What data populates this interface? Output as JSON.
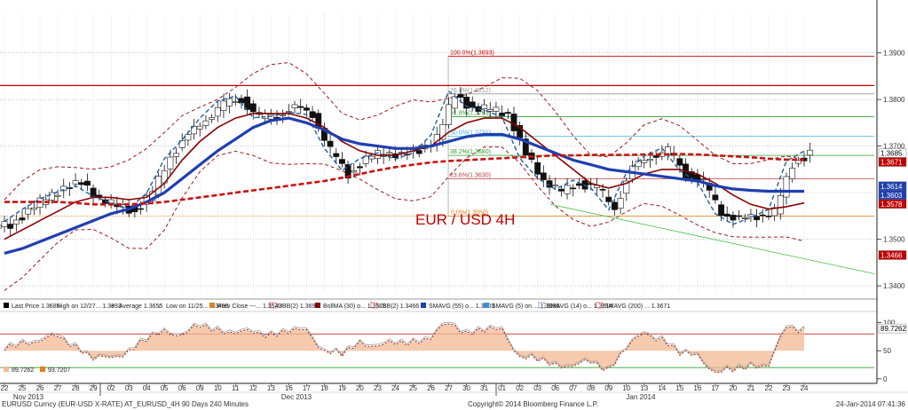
{
  "chart_data": {
    "type": "candlestick",
    "title": "EUR / USD 4H",
    "y_price_ticks": [
      "1.3900",
      "1.3800",
      "1.3700",
      "1.3500",
      "1.3400"
    ],
    "y_osc_ticks": [
      "100",
      "50",
      "0"
    ],
    "ylim_price": [
      1.3385,
      1.3985
    ],
    "ylim_osc": [
      -5,
      112
    ],
    "x_day_labels": [
      "22",
      "25",
      "26",
      "27",
      "28",
      "29",
      "02",
      "03",
      "04",
      "05",
      "06",
      "09",
      "10",
      "11",
      "12",
      "13",
      "16",
      "17",
      "18",
      "19",
      "20",
      "23",
      "24",
      "25",
      "26",
      "27",
      "30",
      "31",
      "01",
      "02",
      "03",
      "06",
      "07",
      "08",
      "09",
      "10",
      "13",
      "14",
      "15",
      "16",
      "17",
      "20",
      "21",
      "22",
      "23",
      "24"
    ],
    "month_labels": [
      "Nov 2013",
      "Dec 2013",
      "Jan 2014"
    ],
    "price_badges": [
      {
        "label": "1.3685",
        "value": 1.3685,
        "bg": "#ffffff",
        "fg": "#000000"
      },
      {
        "label": "1.3671",
        "value": 1.3671,
        "bg": "#c00000",
        "fg": "#ffffff"
      },
      {
        "label": "1.3614",
        "value": 1.3614,
        "bg": "#1f3fb0",
        "fg": "#ffffff"
      },
      {
        "label": "1.3603",
        "value": 1.3603,
        "bg": "#1f3fb0",
        "fg": "#ffffff"
      },
      {
        "label": "1.3578",
        "value": 1.3578,
        "bg": "#c00000",
        "fg": "#ffffff"
      },
      {
        "label": "1.3466",
        "value": 1.3466,
        "bg": "#c00000",
        "fg": "#ffffff"
      }
    ],
    "osc_badge": {
      "label": "89.7262",
      "value": 89.7262
    },
    "osc_values_left": [
      "89.7262",
      "93.7207"
    ],
    "fibonacci": [
      {
        "label": "100.0%(1.3893)",
        "value": 1.3893
      },
      {
        "label": "76.4%(1.3812)",
        "value": 1.3812
      },
      {
        "label": "61.8%(1.3763)",
        "value": 1.3763
      },
      {
        "label": "50.0%(1.3721)",
        "value": 1.3721
      },
      {
        "label": "38.2%(1.3680)",
        "value": 1.368
      },
      {
        "label": "23.6%(1.3630)",
        "value": 1.363
      },
      {
        "label": "0.0%(1.3550)",
        "value": 1.355
      }
    ],
    "resistance_line": 1.383,
    "legend": [
      {
        "text": "Last Price  1.3685",
        "color": "#000000",
        "kind": "square"
      },
      {
        "text": "High on 12/27...  1.3893",
        "color": "#000000",
        "kind": "up"
      },
      {
        "text": "Average  1.3655",
        "color": "#000000",
        "kind": "plus"
      },
      {
        "text": "Low on 11/25...  1.3490",
        "color": "#000000",
        "kind": "down"
      },
      {
        "text": "Prev Close ---...  1.3543",
        "color": "#e08020",
        "kind": "square"
      },
      {
        "text": "UBB(2)  1.3690",
        "color": "#c00000",
        "kind": "dash"
      },
      {
        "text": "BollMA (30) o...  1.3578",
        "color": "#8b0000",
        "kind": "square"
      },
      {
        "text": "LBB(2)  1.3466",
        "color": "#c00000",
        "kind": "dash"
      },
      {
        "text": "SMAVG (55) o...  1.3603",
        "color": "#1f3fb0",
        "kind": "square"
      },
      {
        "text": "SMAVG (5) on ...  1.3686",
        "color": "#3a8fe0",
        "kind": "square"
      },
      {
        "text": "SMAVG (14) o...  1.3614",
        "color": "#1f5fa0",
        "kind": "dash"
      },
      {
        "text": "SMAVG (200) ...  1.3671",
        "color": "#c00000",
        "kind": "dash"
      }
    ],
    "series": [
      {
        "name": "Last Price",
        "closes": [
          1.353,
          1.356,
          1.359,
          1.361,
          1.362,
          1.359,
          1.357,
          1.356,
          1.36,
          1.368,
          1.372,
          1.376,
          1.379,
          1.38,
          1.376,
          1.377,
          1.378,
          1.377,
          1.369,
          1.364,
          1.367,
          1.369,
          1.368,
          1.369,
          1.372,
          1.381,
          1.378,
          1.378,
          1.377,
          1.368,
          1.363,
          1.36,
          1.362,
          1.361,
          1.357,
          1.365,
          1.368,
          1.369,
          1.364,
          1.362,
          1.356,
          1.354,
          1.355,
          1.356,
          1.366,
          1.3685
        ]
      },
      {
        "name": "SMAVG (55)",
        "closes": [
          1.347,
          1.348,
          1.3495,
          1.351,
          1.3525,
          1.354,
          1.3555,
          1.3565,
          1.358,
          1.36,
          1.363,
          1.366,
          1.369,
          1.3715,
          1.374,
          1.3755,
          1.376,
          1.375,
          1.3735,
          1.3715,
          1.3705,
          1.37,
          1.3695,
          1.3695,
          1.37,
          1.371,
          1.372,
          1.3725,
          1.3725,
          1.3715,
          1.37,
          1.3685,
          1.367,
          1.366,
          1.365,
          1.3645,
          1.364,
          1.3635,
          1.363,
          1.3625,
          1.3615,
          1.3608,
          1.3605,
          1.3603,
          1.3603,
          1.3603
        ]
      },
      {
        "name": "SMAVG (200)",
        "closes": [
          1.358,
          1.358,
          1.358,
          1.358,
          1.3578,
          1.3575,
          1.3575,
          1.3575,
          1.3577,
          1.358,
          1.3585,
          1.359,
          1.3595,
          1.36,
          1.3605,
          1.361,
          1.3615,
          1.362,
          1.3625,
          1.3632,
          1.364,
          1.3648,
          1.3655,
          1.366,
          1.3665,
          1.3668,
          1.367,
          1.3672,
          1.3674,
          1.3676,
          1.3678,
          1.368,
          1.368,
          1.3681,
          1.3681,
          1.3681,
          1.3682,
          1.3682,
          1.3683,
          1.3682,
          1.368,
          1.3678,
          1.3676,
          1.3673,
          1.3671,
          1.3671
        ]
      },
      {
        "name": "BollMA (30)",
        "closes": [
          1.35,
          1.352,
          1.354,
          1.356,
          1.358,
          1.359,
          1.359,
          1.3585,
          1.359,
          1.362,
          1.367,
          1.371,
          1.374,
          1.376,
          1.377,
          1.377,
          1.377,
          1.376,
          1.374,
          1.371,
          1.369,
          1.368,
          1.368,
          1.369,
          1.37,
          1.373,
          1.375,
          1.376,
          1.376,
          1.374,
          1.371,
          1.368,
          1.365,
          1.362,
          1.361,
          1.362,
          1.364,
          1.365,
          1.365,
          1.364,
          1.362,
          1.3595,
          1.3575,
          1.3565,
          1.357,
          1.3578
        ]
      }
    ],
    "oscillator": {
      "name": "Oscillator",
      "values": [
        50,
        62,
        74,
        70,
        60,
        40,
        30,
        55,
        70,
        80,
        85,
        90,
        86,
        88,
        76,
        82,
        87,
        80,
        55,
        42,
        60,
        66,
        58,
        66,
        78,
        95,
        86,
        88,
        82,
        45,
        32,
        22,
        30,
        24,
        18,
        60,
        74,
        76,
        46,
        36,
        18,
        12,
        22,
        30,
        86,
        90
      ]
    }
  },
  "footer": {
    "left": "EURUSD Curncy (EUR-USD X-RATE) AT_EURUSD_4H 90 Days 240 Minutes",
    "center": "Copyright© 2014 Bloomberg Finance L.P.",
    "right": "24-Jan-2014 07:41:36"
  }
}
